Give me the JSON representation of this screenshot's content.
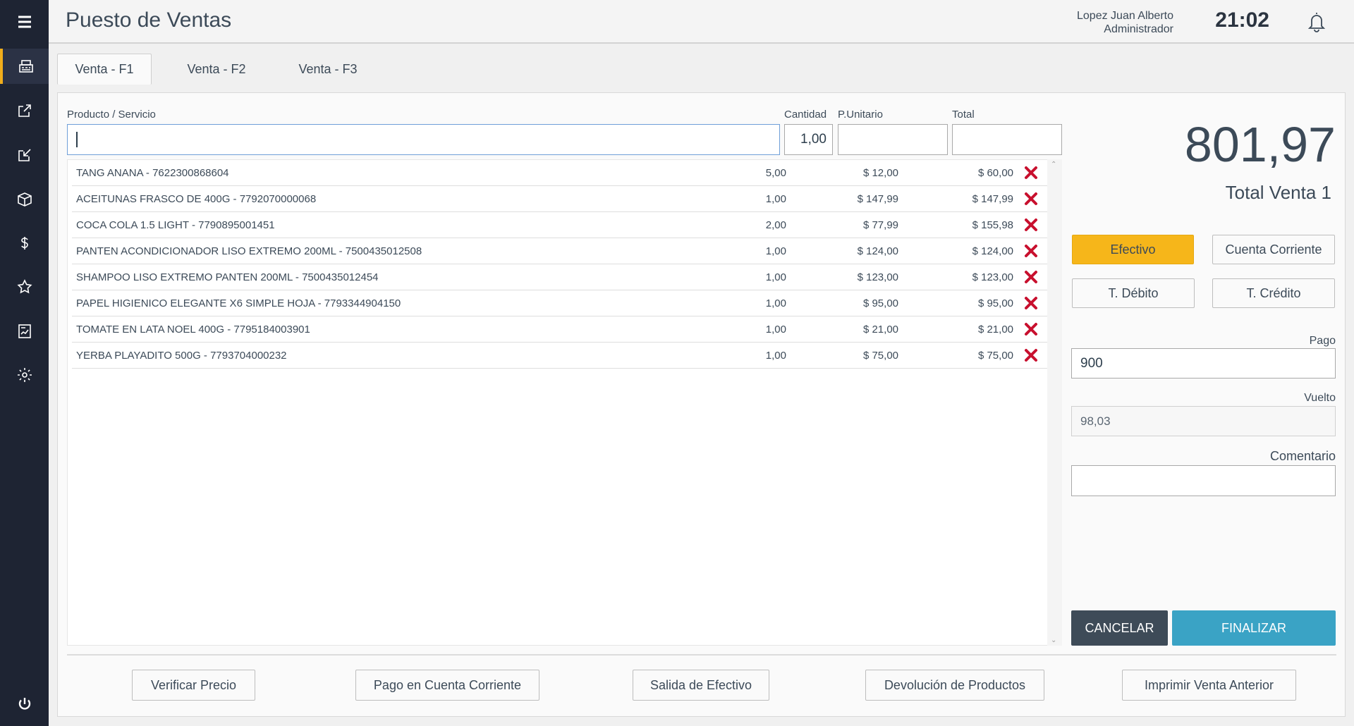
{
  "header": {
    "title": "Puesto de Ventas",
    "user_name": "Lopez Juan Alberto",
    "user_role": "Administrador",
    "time": "21:02"
  },
  "sidebar": {
    "items": [
      {
        "icon": "cash-register-icon",
        "active": true
      },
      {
        "icon": "external-link-icon",
        "active": false
      },
      {
        "icon": "import-icon",
        "active": false
      },
      {
        "icon": "box-icon",
        "active": false
      },
      {
        "icon": "dollar-icon",
        "active": false
      },
      {
        "icon": "star-icon",
        "active": false
      },
      {
        "icon": "report-icon",
        "active": false
      },
      {
        "icon": "gear-icon",
        "active": false
      }
    ],
    "power_icon": "power-icon"
  },
  "tabs": [
    {
      "label": "Venta - F1",
      "active": true
    },
    {
      "label": "Venta - F2",
      "active": false
    },
    {
      "label": "Venta - F3",
      "active": false
    }
  ],
  "entry": {
    "product_label": "Producto / Servicio",
    "product_value": "",
    "qty_label": "Cantidad",
    "qty_value": "1,00",
    "unit_label": "P.Unitario",
    "unit_value": "",
    "total_label": "Total",
    "total_value": ""
  },
  "items": [
    {
      "name": "TANG ANANA - 7622300868604",
      "qty": "5,00",
      "unit": "$  12,00",
      "total": "$  60,00"
    },
    {
      "name": "ACEITUNAS FRASCO DE 400G - 7792070000068",
      "qty": "1,00",
      "unit": "$  147,99",
      "total": "$  147,99"
    },
    {
      "name": "COCA COLA 1.5 LIGHT - 7790895001451",
      "qty": "2,00",
      "unit": "$  77,99",
      "total": "$  155,98"
    },
    {
      "name": "PANTEN ACONDICIONADOR LISO EXTREMO 200ML - 7500435012508",
      "qty": "1,00",
      "unit": "$  124,00",
      "total": "$  124,00"
    },
    {
      "name": "SHAMPOO LISO EXTREMO PANTEN 200ML - 7500435012454",
      "qty": "1,00",
      "unit": "$  123,00",
      "total": "$  123,00"
    },
    {
      "name": "PAPEL HIGIENICO ELEGANTE X6 SIMPLE HOJA - 7793344904150",
      "qty": "1,00",
      "unit": "$  95,00",
      "total": "$  95,00"
    },
    {
      "name": "TOMATE EN LATA NOEL 400G  - 7795184003901",
      "qty": "1,00",
      "unit": "$  21,00",
      "total": "$  21,00"
    },
    {
      "name": "YERBA PLAYADITO 500G - 7793704000232",
      "qty": "1,00",
      "unit": "$  75,00",
      "total": "$  75,00"
    }
  ],
  "summary": {
    "total_amount": "801,97",
    "total_label": "Total Venta 1"
  },
  "payment": {
    "methods": [
      {
        "label": "Efectivo",
        "selected": true
      },
      {
        "label": "Cuenta Corriente",
        "selected": false
      },
      {
        "label": "T. Débito",
        "selected": false
      },
      {
        "label": "T. Crédito",
        "selected": false
      }
    ],
    "pago_label": "Pago",
    "pago_value": "900",
    "vuelto_label": "Vuelto",
    "vuelto_value": "98,03",
    "comentario_label": "Comentario",
    "comentario_value": ""
  },
  "actions": {
    "cancel": "CANCELAR",
    "finish": "FINALIZAR"
  },
  "footer_buttons": [
    "Verificar Precio",
    "Pago en Cuenta Corriente",
    "Salida de Efectivo",
    "Devolución de Productos",
    "Imprimir Venta Anterior"
  ],
  "colors": {
    "sidebar_bg": "#1e2433",
    "accent_yellow": "#f6b61a",
    "finish_blue": "#3aa3c5",
    "cancel_dark": "#3e4b58",
    "delete_red": "#c8102e"
  }
}
